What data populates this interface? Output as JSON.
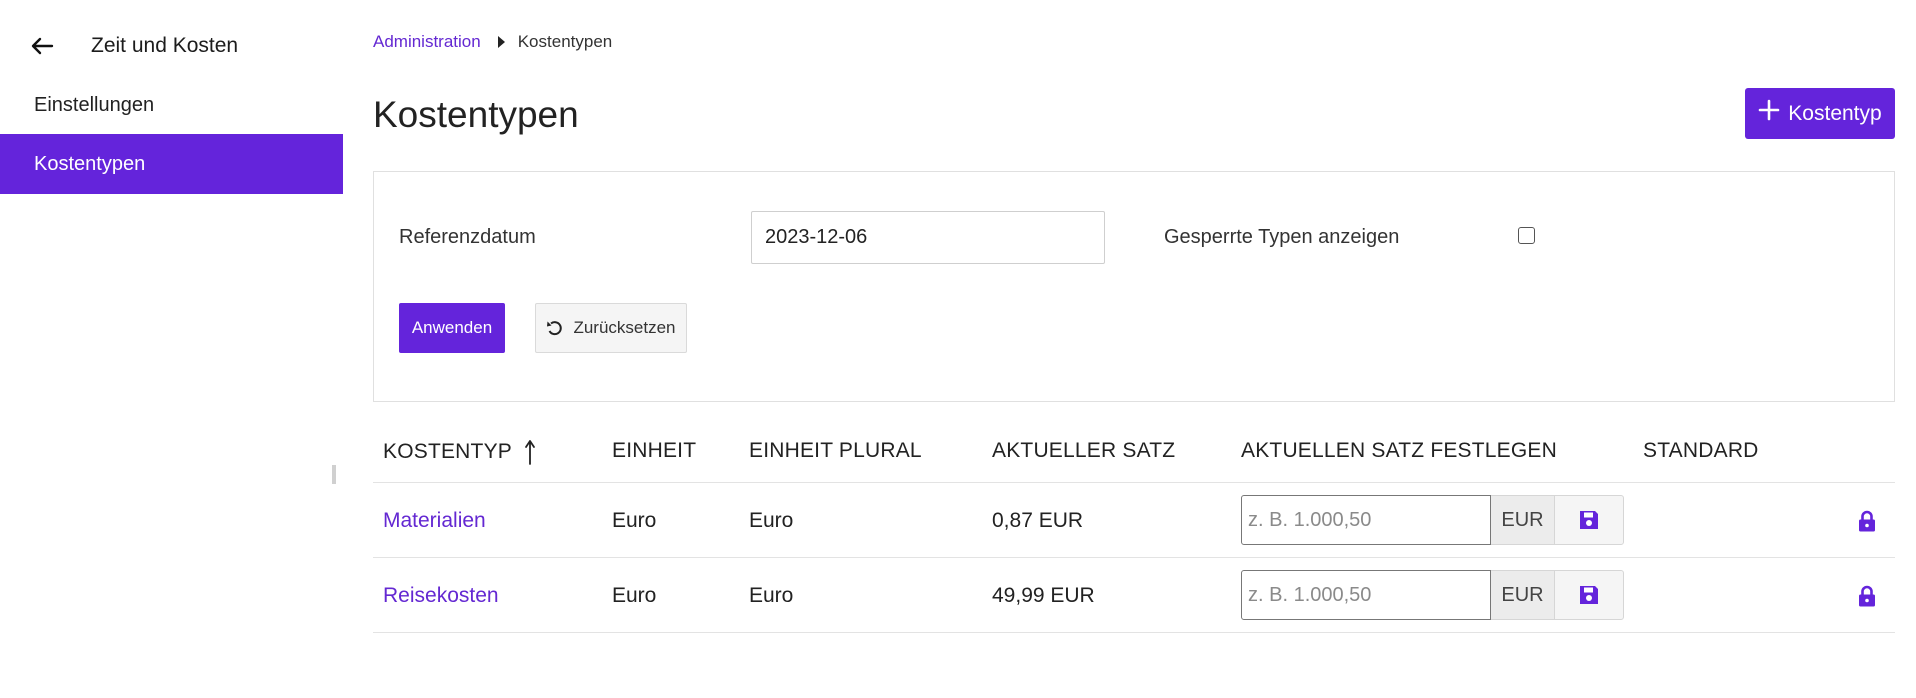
{
  "sidebar": {
    "title": "Zeit und Kosten",
    "items": [
      {
        "label": "Einstellungen",
        "active": false
      },
      {
        "label": "Kostentypen",
        "active": true
      }
    ],
    "active_color": "#6424db"
  },
  "breadcrumb": {
    "items": [
      "Administration",
      "Kostentypen"
    ]
  },
  "page": {
    "title": "Kostentypen",
    "add_button_label": "Kostentyp"
  },
  "filter": {
    "date_label": "Referenzdatum",
    "date_value": "2023-12-06",
    "locked_label": "Gesperrte Typen anzeigen",
    "locked_checked": false,
    "apply_label": "Anwenden",
    "reset_label": "Zurücksetzen"
  },
  "table": {
    "headers": [
      "KOSTENTYP",
      "EINHEIT",
      "EINHEIT PLURAL",
      "AKTUELLER SATZ",
      "AKTUELLEN SATZ FESTLEGEN",
      "STANDARD"
    ],
    "sort_column": "KOSTENTYP",
    "sort_direction": "ascending",
    "rate_placeholder": "z. B. 1.000,50",
    "currency": "EUR",
    "rows": [
      {
        "name": "Materialien",
        "unit": "Euro",
        "unit_plural": "Euro",
        "rate": "0,87 EUR"
      },
      {
        "name": "Reisekosten",
        "unit": "Euro",
        "unit_plural": "Euro",
        "rate": "49,99 EUR"
      }
    ]
  },
  "colors": {
    "accent": "#6424db",
    "link": "#6428d2"
  }
}
